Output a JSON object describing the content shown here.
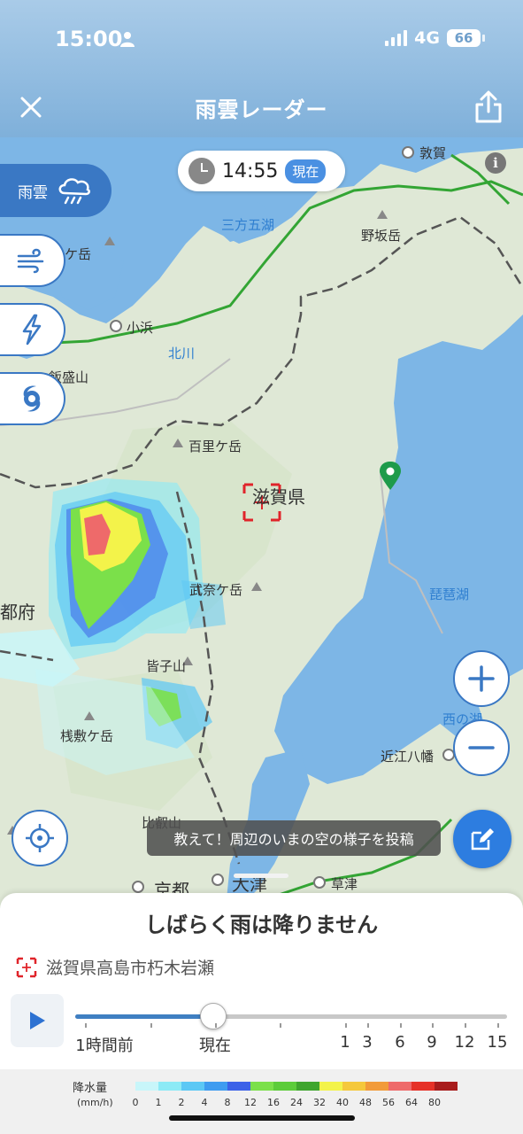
{
  "status_bar": {
    "time": "15:00",
    "network": "4G",
    "battery": "66"
  },
  "header": {
    "title": "雨雲レーダー",
    "close_icon": "close-icon",
    "share_icon": "share-icon"
  },
  "map": {
    "time_pill": {
      "time": "14:55",
      "badge": "現在"
    },
    "layers": {
      "rain_label": "雨雲"
    },
    "labels": {
      "tsuruga": "敦賀",
      "mikatagoko": "三方五湖",
      "nosakadake": "野坂岳",
      "kedake": "ケ岳",
      "obama": "小浜",
      "kitagawa": "北川",
      "iimoriyama": "飯盛山",
      "hyakurigatake": "百里ケ岳",
      "shiga": "滋賀県",
      "bukagatake": "武奈ケ岳",
      "biwako": "琵琶湖",
      "kyotofu": "都府",
      "minagoyama": "皆子山",
      "sajikigatake": "桟敷ケ岳",
      "nishinoko": "西の湖",
      "omihachiman": "近江八幡",
      "hieizan": "比叡山",
      "kyoto": "京都",
      "otsu": "大津",
      "kusatsu": "草津"
    },
    "post_banner": "教えて！周辺のいまの空の様子を投稿",
    "zoom": {
      "in": "+",
      "out": "−"
    }
  },
  "sheet": {
    "title": "しばらく雨は降りません",
    "location": "滋賀県高島市朽木岩瀬",
    "slider": {
      "position_fraction": 0.32,
      "labels": [
        "1時間前",
        "現在",
        "1",
        "3",
        "6",
        "9",
        "12",
        "15"
      ]
    }
  },
  "legend": {
    "title": "降水量",
    "unit": "(mm/h)",
    "values": [
      "0",
      "1",
      "2",
      "4",
      "8",
      "12",
      "16",
      "24",
      "32",
      "40",
      "48",
      "56",
      "64",
      "80"
    ],
    "colors": [
      "#c8f6fa",
      "#8ceaf6",
      "#5cc8f5",
      "#3f9cf0",
      "#3c62e8",
      "#7be04a",
      "#5ccc3a",
      "#3fa52e",
      "#f3f34a",
      "#f5c83c",
      "#f29b3a",
      "#ee6a6a",
      "#e63228",
      "#a81d1d"
    ]
  },
  "colors": {
    "accent": "#3a78c4",
    "fab": "#2d7de0",
    "pin": "#1e9b4b",
    "water": "#7db6e6"
  }
}
